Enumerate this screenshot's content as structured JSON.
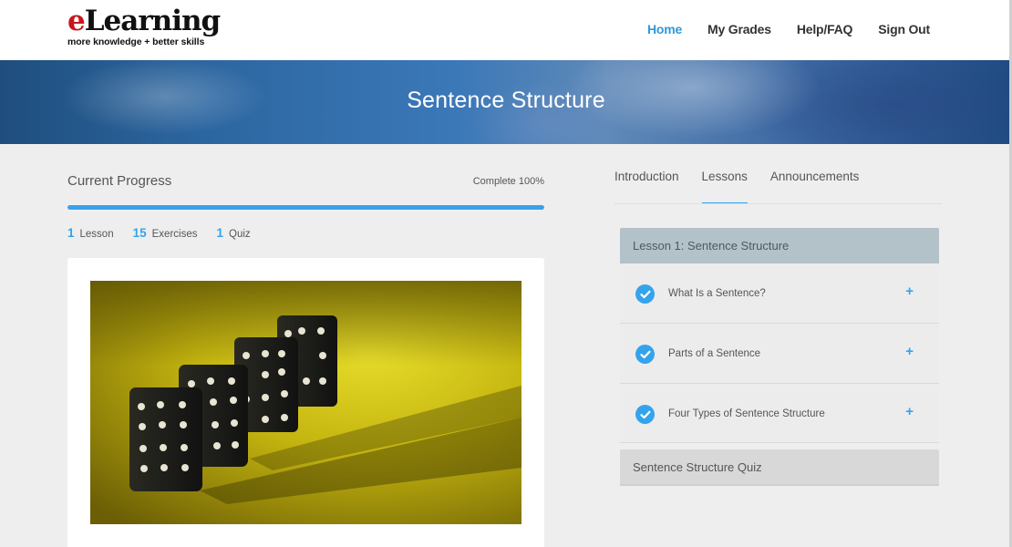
{
  "header": {
    "logo_e": "e",
    "logo_rest": "Learning",
    "logo_tagline": "more knowledge + better skills",
    "nav": [
      {
        "label": "Home",
        "active": true
      },
      {
        "label": "My Grades",
        "active": false
      },
      {
        "label": "Help/FAQ",
        "active": false
      },
      {
        "label": "Sign Out",
        "active": false
      }
    ]
  },
  "banner": {
    "title": "Sentence Structure"
  },
  "progress": {
    "title": "Current Progress",
    "complete_label": "Complete 100%",
    "percent": 100,
    "stats": [
      {
        "count": "1",
        "label": "Lesson"
      },
      {
        "count": "15",
        "label": "Exercises"
      },
      {
        "count": "1",
        "label": "Quiz"
      }
    ]
  },
  "tabs": [
    {
      "label": "Introduction",
      "active": false
    },
    {
      "label": "Lessons",
      "active": true
    },
    {
      "label": "Announcements",
      "active": false
    }
  ],
  "lesson": {
    "title": "Lesson 1: Sentence Structure",
    "items": [
      {
        "label": "What Is a Sentence?",
        "icon": "check-icon",
        "expand": "+"
      },
      {
        "label": "Parts of a Sentence",
        "icon": "check-icon",
        "expand": "+"
      },
      {
        "label": "Four Types of Sentence Structure",
        "icon": "check-icon",
        "expand": "+"
      }
    ]
  },
  "quiz": {
    "title": "Sentence Structure Quiz"
  },
  "colors": {
    "accent": "#35a3eb",
    "nav_active": "#2f97db",
    "lesson_header": "#b3c1c8",
    "logo_red": "#c8161d"
  }
}
